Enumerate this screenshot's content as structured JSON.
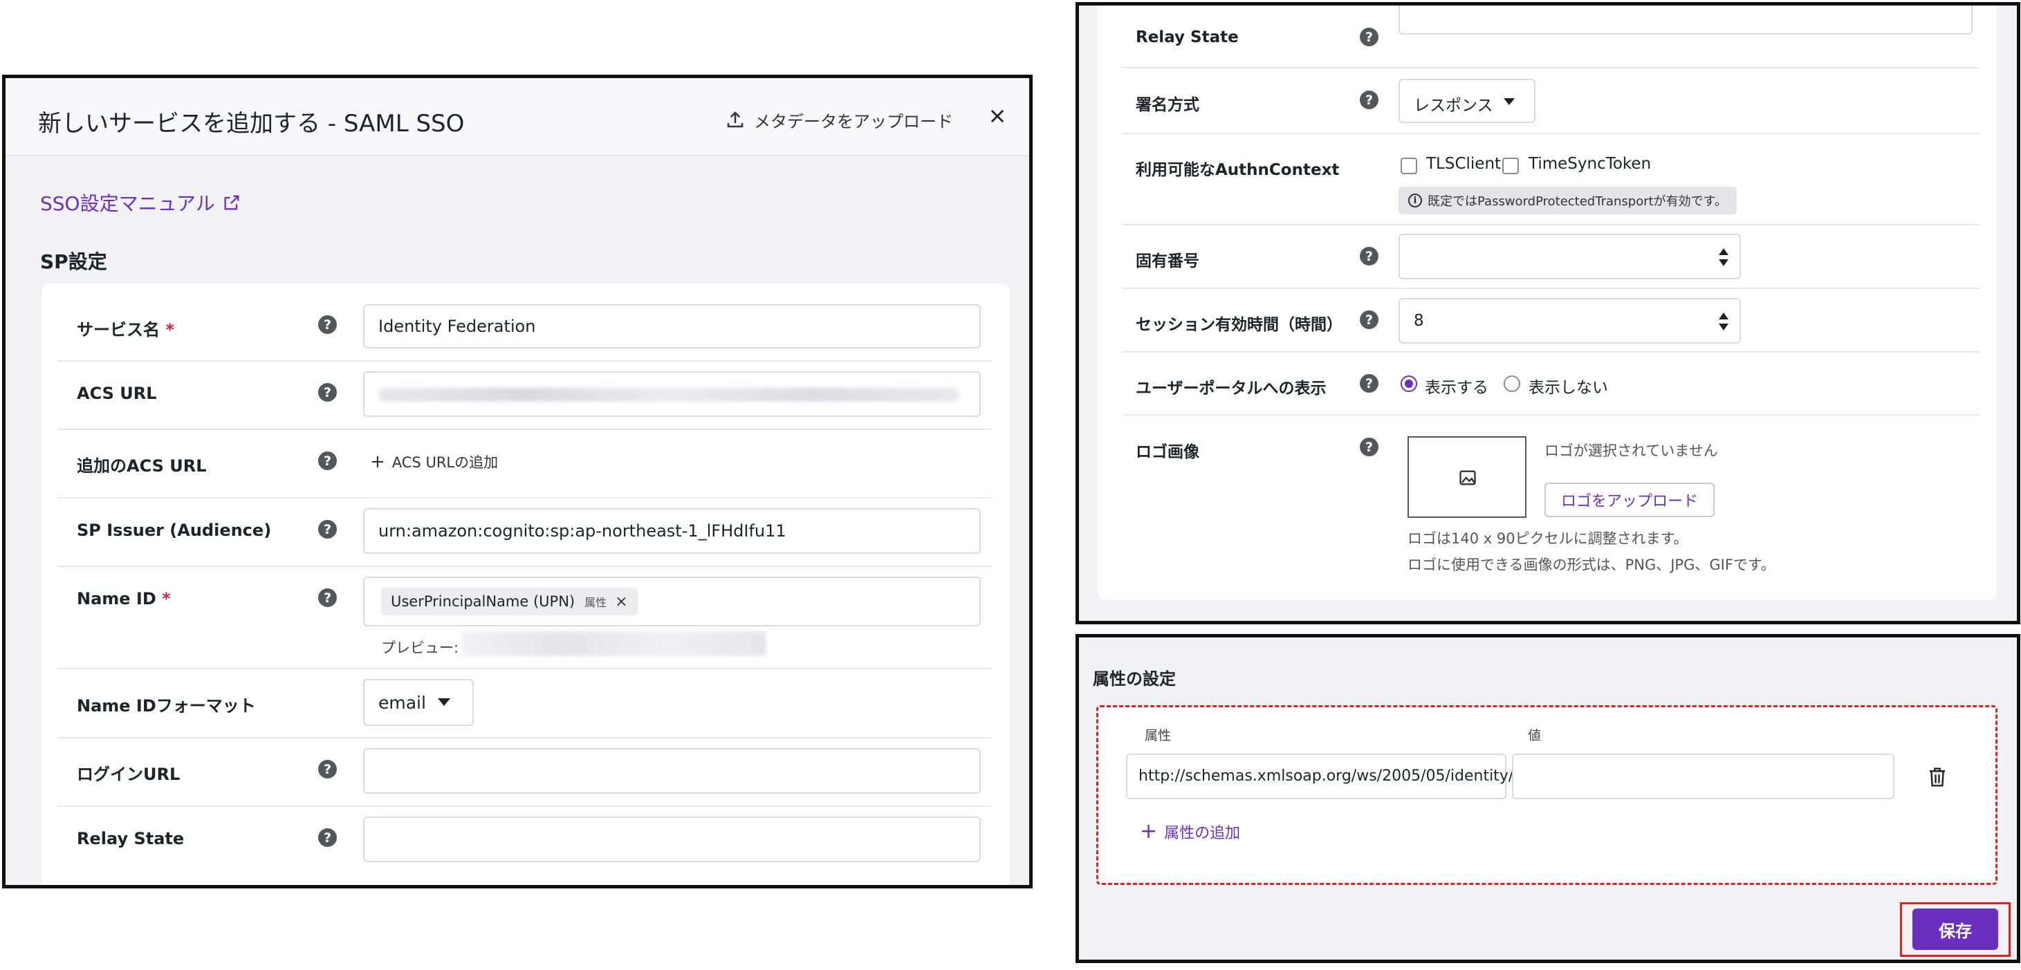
{
  "modal": {
    "title": "新しいサービスを追加する - SAML SSO",
    "upload_metadata_label": "メタデータをアップロード",
    "sso_manual_link": "SSO設定マニュアル",
    "sp_section_title": "SP設定",
    "fields": {
      "service_name": {
        "label": "サービス名",
        "value": "Identity Federation",
        "required": "*"
      },
      "acs_url": {
        "label": "ACS URL"
      },
      "additional_acs": {
        "label": "追加のACS URL",
        "add_label": "ACS URLの追加"
      },
      "sp_issuer": {
        "label": "SP Issuer (Audience)",
        "value": "urn:amazon:cognito:sp:ap-northeast-1_lFHdIfu11"
      },
      "name_id": {
        "label": "Name ID",
        "required": "*",
        "chip_text": "UserPrincipalName (UPN)",
        "chip_tag": "属性",
        "preview_label": "プレビュー:"
      },
      "name_id_format": {
        "label": "Name IDフォーマット",
        "value": "email"
      },
      "login_url": {
        "label": "ログインURL"
      },
      "relay_state": {
        "label": "Relay State"
      }
    }
  },
  "right_panel": {
    "relay_state_label": "Relay State",
    "signing_method": {
      "label": "署名方式",
      "value": "レスポンス"
    },
    "authn_context": {
      "label": "利用可能なAuthnContext",
      "options": [
        "TLSClient",
        "TimeSyncToken"
      ],
      "note": "既定ではPasswordProtectedTransportが有効です。"
    },
    "unique_number": {
      "label": "固有番号",
      "value": ""
    },
    "session_duration": {
      "label": "セッション有効時間（時間）",
      "value": "8"
    },
    "user_portal": {
      "label": "ユーザーポータルへの表示",
      "show": "表示する",
      "hide": "表示しない",
      "selected": "表示する"
    },
    "logo": {
      "label": "ロゴ画像",
      "none_selected": "ロゴが選択されていません",
      "upload_label": "ロゴをアップロード",
      "size_note": "ロゴは140 x 90ピクセルに調整されます。",
      "format_note": "ロゴに使用できる画像の形式は、PNG、JPG、GIFです。"
    }
  },
  "attributes": {
    "title": "属性の設定",
    "attr_header": "属性",
    "value_header": "値",
    "attr_value": "http://schemas.xmlsoap.org/ws/2005/05/identity/",
    "value_value": "",
    "add_label": "属性の追加",
    "save_label": "保存"
  },
  "icons": {
    "upload": "upload-icon",
    "close": "close-icon",
    "external_link": "external-link-icon",
    "help": "question-circle-icon",
    "plus": "plus-icon",
    "info": "info-circle-icon",
    "image": "image-placeholder-icon",
    "trash": "trash-icon",
    "caret": "caret-down-icon"
  },
  "colors": {
    "accent": "#6b2fc0",
    "required": "#d0213d",
    "highlight_border": "#e02020",
    "panel_bg": "#f2f2f5"
  }
}
